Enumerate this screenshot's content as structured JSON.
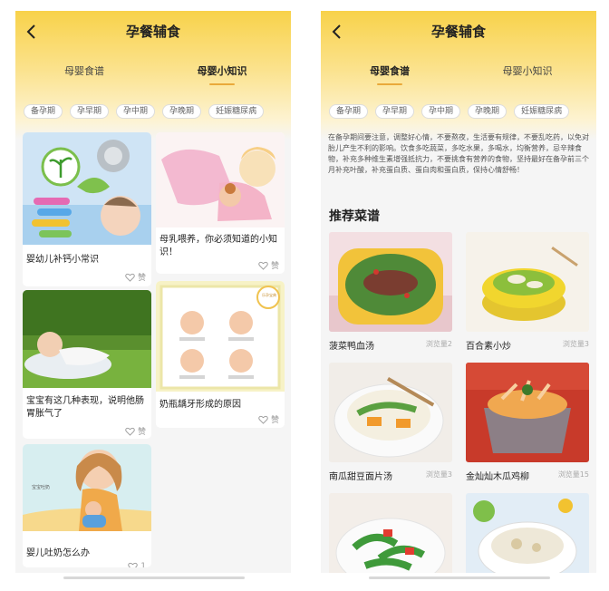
{
  "left": {
    "title": "孕餐辅食",
    "tabs": [
      {
        "label": "母婴食谱",
        "active": false
      },
      {
        "label": "母婴小知识",
        "active": true
      }
    ],
    "chips": [
      "备孕期",
      "孕早期",
      "孕中期",
      "孕晚期",
      "妊娠糖尿病"
    ],
    "articles": [
      {
        "title": "婴幼儿补钙小常识",
        "likes": "赞"
      },
      {
        "title": "母乳喂养，你必须知道的小知识！",
        "likes": "赞"
      },
      {
        "title": "宝宝有这几种表现，说明他肠胃胀气了",
        "likes": "赞"
      },
      {
        "title": "奶瓶龋牙形成的原因",
        "likes": "赞"
      },
      {
        "title": "婴儿吐奶怎么办",
        "likes": "1"
      }
    ],
    "image_texts": {
      "cartoon_label": "宝宝吐奶",
      "badge": "乐孕宝典"
    }
  },
  "right": {
    "title": "孕餐辅食",
    "tabs": [
      {
        "label": "母婴食谱",
        "active": true
      },
      {
        "label": "母婴小知识",
        "active": false
      }
    ],
    "chips": [
      "备孕期",
      "孕早期",
      "孕中期",
      "孕晚期",
      "妊娠糖尿病"
    ],
    "intro": "在备孕期间要注意，调整好心情，不要熬夜，生活要有规律，不要乱吃药，以免对胎儿产生不利的影响。饮食多吃蔬菜，多吃水果，多喝水，均衡营养，忌辛辣食物，补充多种维生素增强抵抗力，不要挑食有营养的食物，坚持最好在备孕前三个月补充叶酸，补充蛋白质、蛋白肉和蛋白质，保持心情舒畅！",
    "section_title": "推荐菜谱",
    "recipes": [
      {
        "name": "菠菜鸭血汤",
        "views": "浏览量2"
      },
      {
        "name": "百合素小炒",
        "views": "浏览量3"
      },
      {
        "name": "南瓜甜豆面片汤",
        "views": "浏览量3"
      },
      {
        "name": "金灿灿木瓜鸡柳",
        "views": "浏览量15"
      },
      {
        "name": "",
        "views": ""
      },
      {
        "name": "",
        "views": ""
      }
    ]
  },
  "colors": {
    "header_yellow": "#f8d24a",
    "tab_indicator": "#e9a93a",
    "background": "#f5f5f5"
  },
  "icons": [
    "back-arrow-icon",
    "heart-icon"
  ]
}
